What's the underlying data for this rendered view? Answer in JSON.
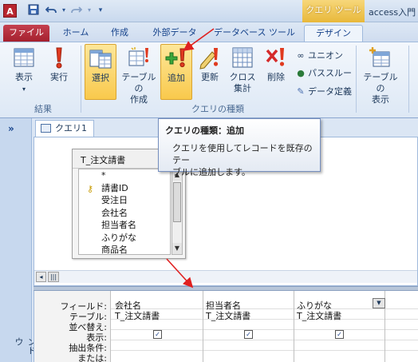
{
  "titlebar": {
    "app_icon": "A",
    "qat_icons": [
      "save-icon",
      "undo-icon",
      "redo-icon"
    ],
    "context_tab_title": "クエリ ツール",
    "document_title": "access入門"
  },
  "tabs": {
    "file": "ファイル",
    "home": "ホーム",
    "create": "作成",
    "external": "外部データ",
    "dbtools": "データベース ツール",
    "design": "デザイン"
  },
  "ribbon": {
    "results": {
      "view": "表示",
      "run": "実行",
      "group_label": "結果"
    },
    "query_type": {
      "select": "選択",
      "make_table_1": "テーブルの",
      "make_table_2": "作成",
      "append": "追加",
      "update": "更新",
      "crosstab_1": "クロス",
      "crosstab_2": "集計",
      "delete": "削除",
      "group_label": "クエリの種類"
    },
    "small": {
      "union": "ユニオン",
      "passthrough": "パススルー",
      "data_definition": "データ定義"
    },
    "show_table_1": "テーブルの",
    "show_table_2": "表示"
  },
  "tooltip": {
    "title": "クエリの種類：追加",
    "body_1": "クエリを使用してレコードを既存のテー",
    "body_2": "ブルに追加します。"
  },
  "nav": {
    "chevron": "»",
    "vertical_label": "ンドウ"
  },
  "doc_tab": {
    "label": "クエリ1"
  },
  "table_box": {
    "title": "T_注文請書",
    "fields": [
      "*",
      "請書ID",
      "受注日",
      "会社名",
      "担当者名",
      "ふりがな",
      "商品名"
    ],
    "key_field_index": 1
  },
  "grid": {
    "row_labels": [
      "フィールド:",
      "テーブル:",
      "並べ替え:",
      "表示:",
      "抽出条件:",
      "または:"
    ],
    "columns": [
      {
        "field": "会社名",
        "table": "T_注文請書",
        "show": true
      },
      {
        "field": "担当者名",
        "table": "T_注文請書",
        "show": true
      },
      {
        "field": "ふりがな",
        "table": "T_注文請書",
        "show": true
      }
    ]
  },
  "colors": {
    "accent_yellow": "#f9c94c",
    "file_tab_red": "#a5202e",
    "annotation_red": "#e02020",
    "ribbon_blue": "#dde8f5"
  }
}
